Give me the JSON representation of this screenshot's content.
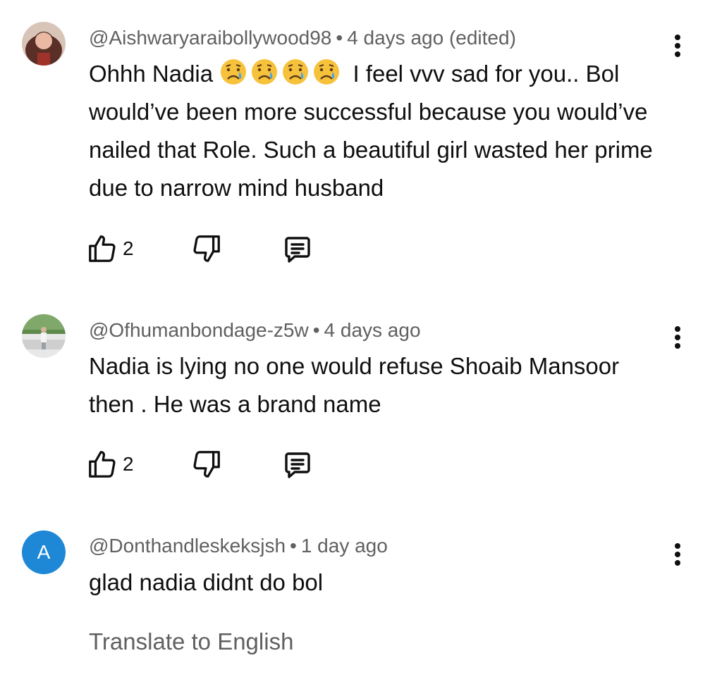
{
  "comments": [
    {
      "handle": "@Aishwaryaraibollywood98",
      "time": "4 days ago (edited)",
      "text_before_emoji": "Ohhh Nadia",
      "emoji": [
        "crying-face-emoji",
        "crying-face-emoji",
        "crying-face-emoji",
        "crying-face-emoji"
      ],
      "text_after_emoji": "I feel vvv sad for you.. Bol would’ve been more successful because you would’ve nailed that Role. Such a beautiful girl wasted her prime due to narrow mind husband",
      "likes": "2",
      "avatar": "photo-avatar"
    },
    {
      "handle": "@Ofhumanbondage-z5w",
      "time": "4 days ago",
      "text": "Nadia is lying no one would refuse Shoaib Mansoor then . He was a brand name",
      "likes": "2",
      "avatar": "photo-avatar"
    },
    {
      "handle": "@Donthandleskeksjsh",
      "time": "1 day ago",
      "text": "glad nadia didnt do bol",
      "avatar_letter": "A"
    }
  ],
  "translate_label": "Translate to English",
  "colors": {
    "avatar_letter_bg": "#1e88d6",
    "meta_text": "#606060",
    "body_text": "#0f0f0f"
  },
  "icons": [
    "like-icon",
    "dislike-icon",
    "reply-icon",
    "more-options-icon"
  ]
}
